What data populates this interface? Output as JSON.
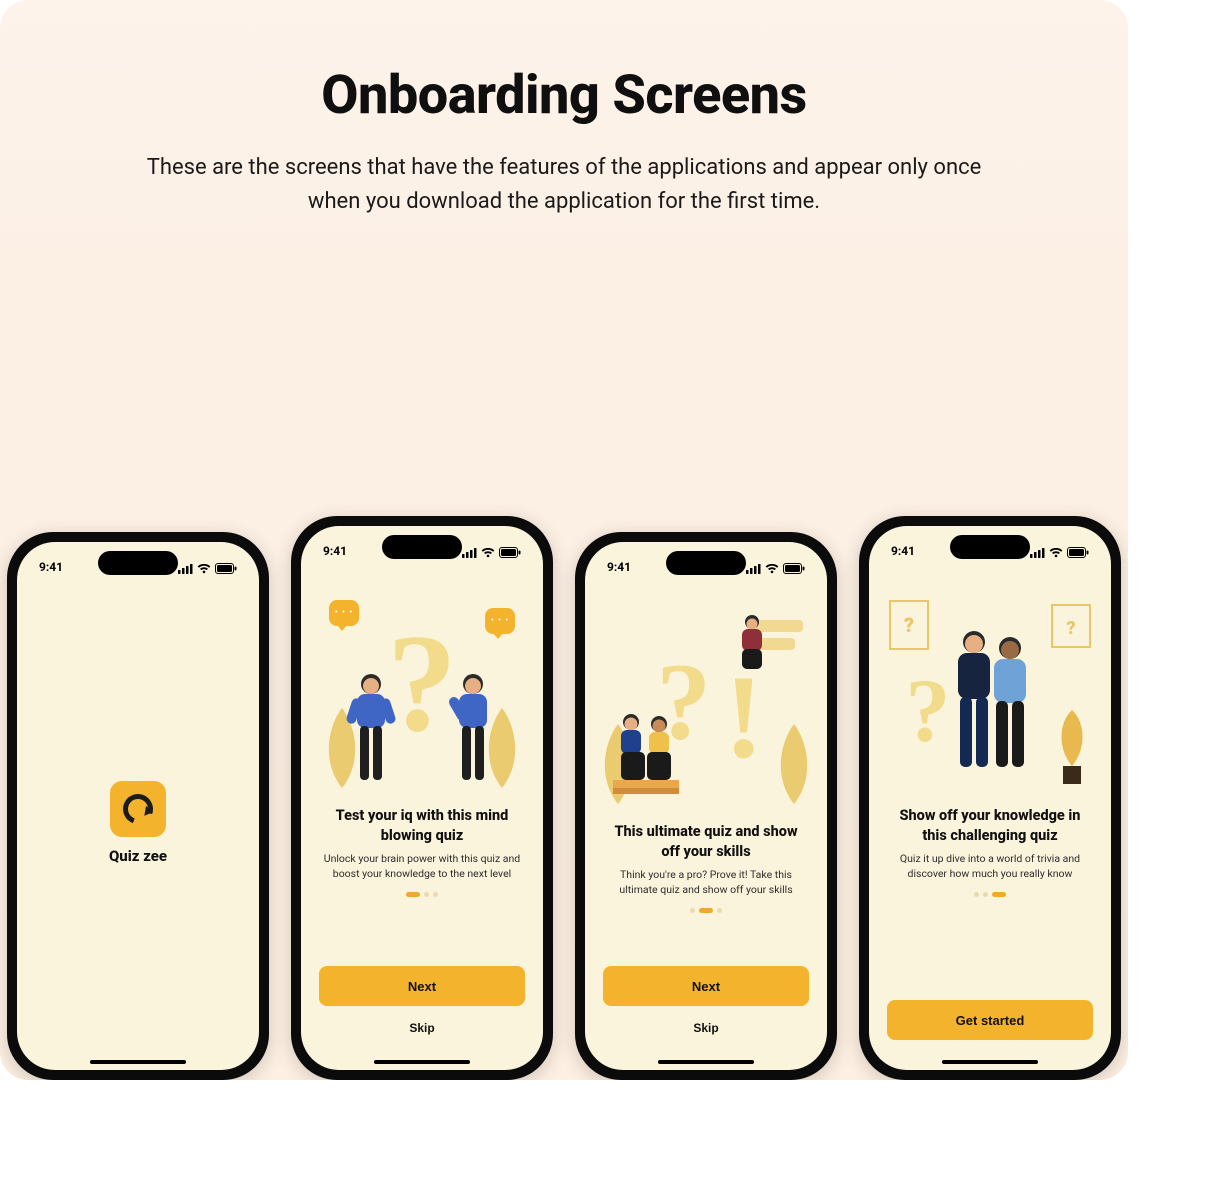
{
  "page": {
    "title": "Onboarding Screens",
    "description": "These are the screens that have the features of the applications and appear only once when you download the application for the first time."
  },
  "status": {
    "time": "9:41"
  },
  "brand": {
    "name": "Quiz zee"
  },
  "screens": [
    {
      "id": "splash",
      "type": "splash"
    },
    {
      "id": "ob1",
      "title": "Test your iq with this mind blowing quiz",
      "subtitle": "Unlock your brain power with this quiz and boost your knowledge to the next level",
      "primary": "Next",
      "secondary": "Skip",
      "active_dot": 0,
      "dot_count": 3
    },
    {
      "id": "ob2",
      "title": "This ultimate quiz and show off your skills",
      "subtitle": "Think you're a pro? Prove it! Take this ultimate quiz and show off your skills",
      "primary": "Next",
      "secondary": "Skip",
      "active_dot": 1,
      "dot_count": 3
    },
    {
      "id": "ob3",
      "title": "Show off your knowledge in this challenging quiz",
      "subtitle": "Quiz it up dive into a world of trivia and discover how much you really know",
      "primary": "Get started",
      "secondary": "",
      "active_dot": 2,
      "dot_count": 3
    }
  ],
  "colors": {
    "accent": "#f3b32c",
    "screen_bg": "#fbf4dc",
    "page_bg_top": "#fdf3ea"
  }
}
